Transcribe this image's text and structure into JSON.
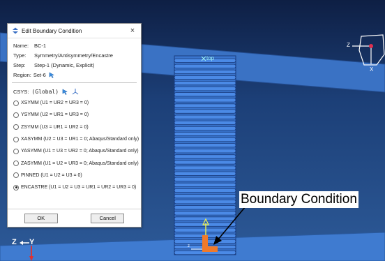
{
  "dialog": {
    "title": "Edit Boundary Condition",
    "close_glyph": "×",
    "fields": [
      {
        "key": "Name:",
        "value": "BC-1"
      },
      {
        "key": "Type:",
        "value": "Symmetry/Antisymmetry/Encastre"
      },
      {
        "key": "Step:",
        "value": "Step-1 (Dynamic, Explicit)"
      },
      {
        "key": "Region:",
        "value": "Set-6"
      }
    ],
    "csys_label": "CSYS:",
    "csys_value": "(Global)",
    "options": [
      {
        "label": "XSYMM (U1 = UR2 = UR3 = 0)",
        "selected": false
      },
      {
        "label": "YSYMM (U2 = UR1 = UR3 = 0)",
        "selected": false
      },
      {
        "label": "ZSYMM (U3 = UR1 = UR2 = 0)",
        "selected": false
      },
      {
        "label": "XASYMM (U2 = U3 = UR1 = 0; Abaqus/Standard only)",
        "selected": false
      },
      {
        "label": "YASYMM (U1 = U3 = UR2 = 0; Abaqus/Standard only)",
        "selected": false
      },
      {
        "label": "ZASYMM (U1 = U2 = UR3 = 0; Abaqus/Standard only)",
        "selected": false
      },
      {
        "label": "PINNED (U1 = U2 = U3 = 0)",
        "selected": false
      },
      {
        "label": "ENCASTRE (U1 = U2 = U3 = UR1 = UR2 = UR3 = 0)",
        "selected": true
      }
    ],
    "ok_label": "OK",
    "cancel_label": "Cancel"
  },
  "viewport": {
    "annotation": "Boundary Condition",
    "top_label": "top",
    "axis_z": "Z",
    "axis_y": "Y",
    "triad_z": "Z",
    "triad_x": "X",
    "local_z": "z"
  },
  "icons": [
    "dialog-title-icon",
    "close-icon",
    "region-pick-icon",
    "csys-pick-icon",
    "csys-axes-icon"
  ],
  "colors": {
    "background_top": "#0e1f44",
    "background_bottom": "#2d5a98",
    "column_fill": "#3d79d4",
    "bc_marker": "#f07a2a"
  }
}
